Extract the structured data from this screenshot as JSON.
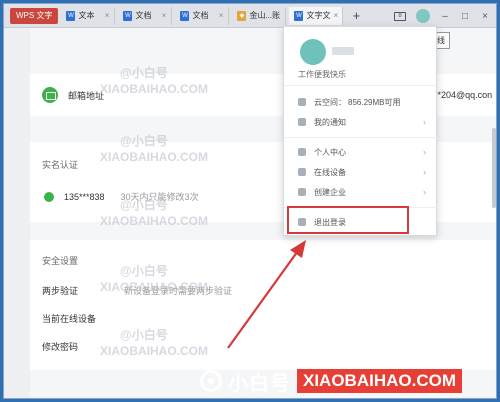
{
  "tabs": {
    "app_label": "WPS 文字",
    "docs": [
      {
        "label": "文本",
        "icon": "doc-icon"
      },
      {
        "label": "文档",
        "icon": "doc-icon"
      },
      {
        "label": "文档",
        "icon": "doc-icon"
      },
      {
        "label": "金山...账",
        "icon": "orange-icon"
      },
      {
        "label": "文字文",
        "icon": "doc-icon"
      }
    ],
    "new_tab": "+"
  },
  "window": {
    "badge": "8",
    "minimize": "–",
    "maximize": "□",
    "close": "×",
    "tooltip": "在线"
  },
  "account": {
    "email_label": "邮箱地址",
    "email_value": "**204@qq.con",
    "realname_section": "实名认证",
    "phone": "135***838",
    "phone_note": "30天内只能修改3次",
    "security_section": "安全设置",
    "two_step_label": "两步验证",
    "two_step_note": "新设备登录时需要两步验证",
    "online_devices": "当前在线设备",
    "change_password": "修改密码"
  },
  "panel": {
    "tagline": "工作便我快乐",
    "cloud_label": "云空间：",
    "cloud_value": "856.29MB可用",
    "notice": "我的通知",
    "personal_center": "个人中心",
    "online_device": "在线设备",
    "create_company": "创建企业",
    "logout": "退出登录"
  },
  "watermark": {
    "brand_cn": "@小白号",
    "brand_en": "XIAOBAIHAO.COM",
    "footer_cn": "小白号",
    "footer_en": "XIAOBAIHAO.COM"
  },
  "colors": {
    "highlight": "#d6393a",
    "accent_green": "#3bb34a",
    "app_red": "#c9473c"
  }
}
